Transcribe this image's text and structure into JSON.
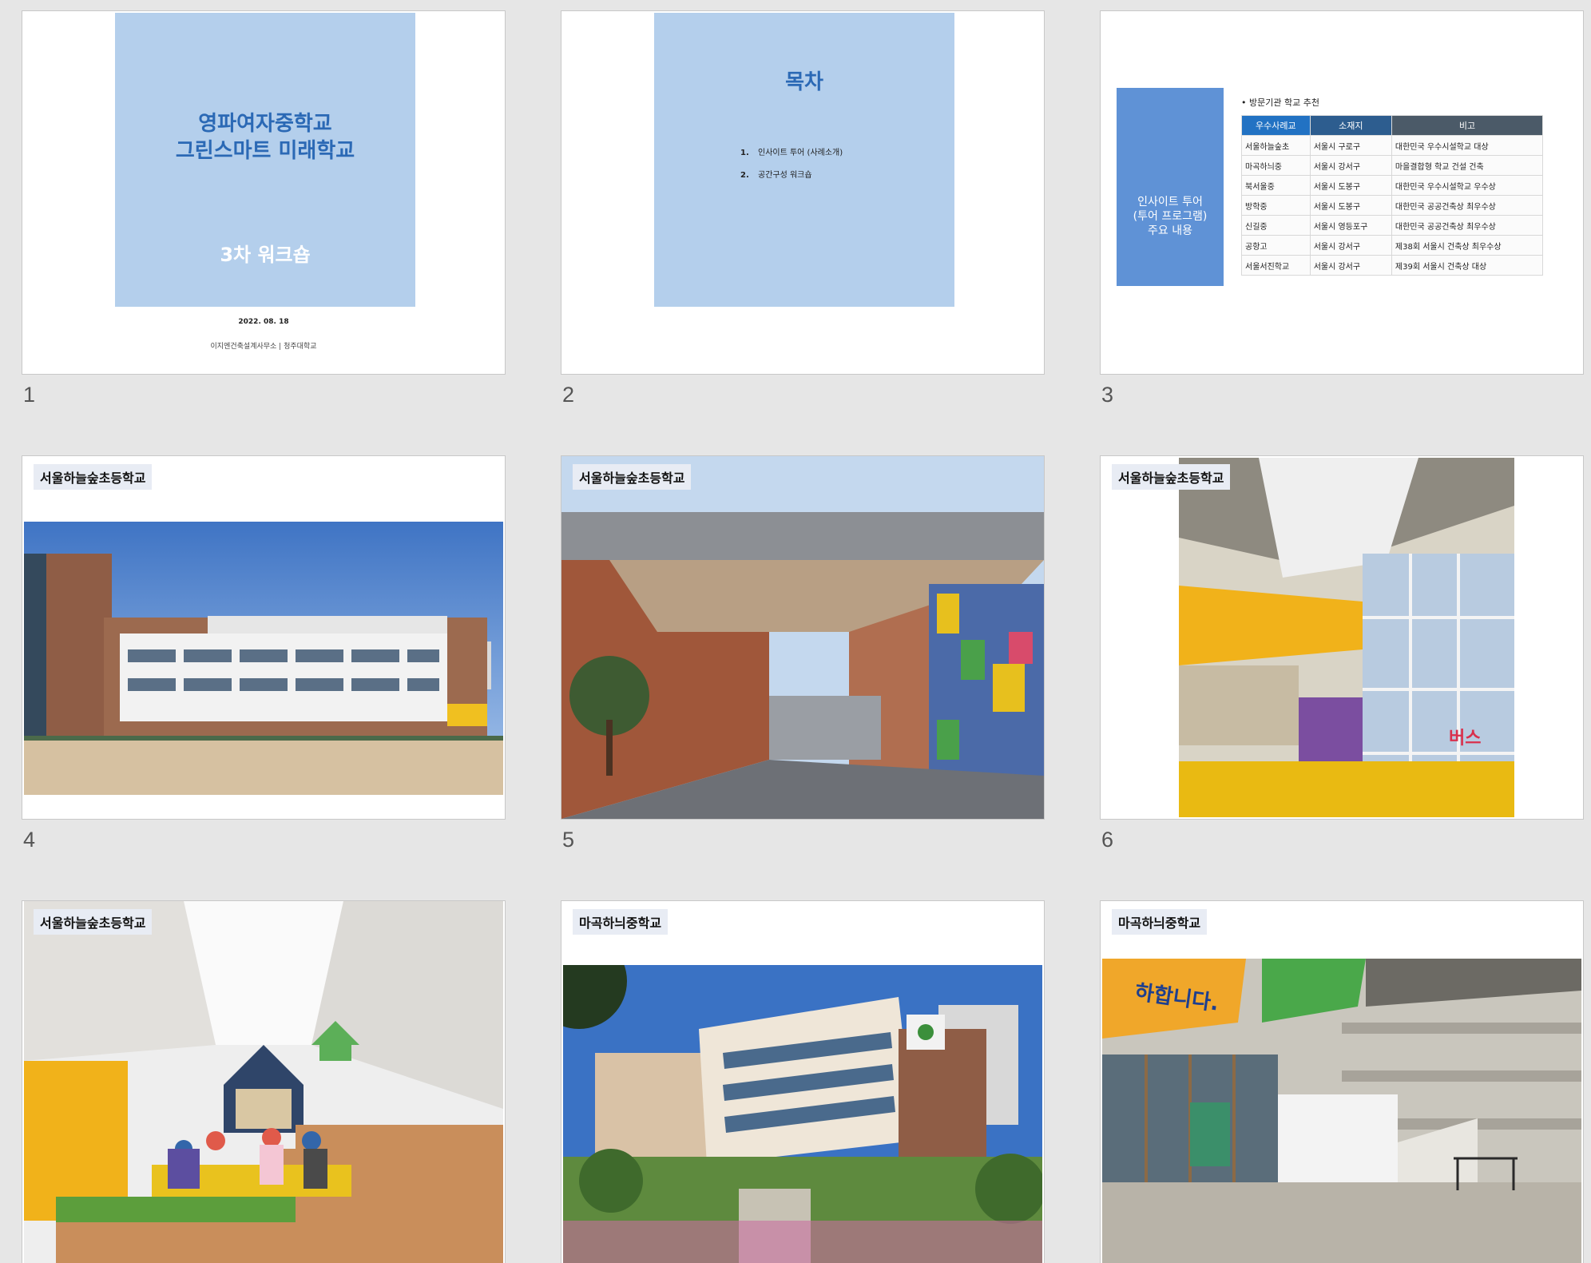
{
  "slides": [
    {
      "number": "1",
      "title": "영파여자중학교\n그린스마트 미래학교",
      "subtitle": "3차 워크숍",
      "date": "2022. 08. 18",
      "organization": "이지엔건축설계사무소 | 청주대학교"
    },
    {
      "number": "2",
      "title": "목차",
      "items": [
        {
          "num": "1.",
          "text": "인사이트 투어 (사례소개)"
        },
        {
          "num": "2.",
          "text": "공간구성 워크숍"
        }
      ]
    },
    {
      "number": "3",
      "left_box": "인사이트 투어\n(투어 프로그램)\n주요 내용",
      "heading": "• 방문기관 학교 추천",
      "table": {
        "headers": [
          "우수사례교",
          "소재지",
          "비고"
        ],
        "rows": [
          [
            "서울하늘숲초",
            "서울시 구로구",
            "대한민국 우수시설학교 대상"
          ],
          [
            "마곡하늬중",
            "서울시 강서구",
            "마을결합형 학교 건설 건축"
          ],
          [
            "북서울중",
            "서울시 도봉구",
            "대한민국 우수시설학교 우수상"
          ],
          [
            "방학중",
            "서울시 도봉구",
            "대한민국 공공건축상 최우수상"
          ],
          [
            "신길중",
            "서울시 영등포구",
            "대한민국 공공건축상 최우수상"
          ],
          [
            "공항고",
            "서울시 강서구",
            "제38회 서울시 건축상 최우수상"
          ],
          [
            "서울서진학교",
            "서울시 강서구",
            "제39회 서울시 건축상 대상"
          ]
        ]
      }
    },
    {
      "number": "4",
      "label": "서울하늘숲초등학교"
    },
    {
      "number": "5",
      "label": "서울하늘숲초등학교"
    },
    {
      "number": "6",
      "label": "서울하늘숲초등학교",
      "sign": "버스"
    },
    {
      "number": "7",
      "label": "서울하늘숲초등학교"
    },
    {
      "number": "8",
      "label": "마곡하늬중학교"
    },
    {
      "number": "9",
      "label": "마곡하늬중학교",
      "banner": "하합니다."
    }
  ],
  "colors": {
    "accent_blue": "#2b69b5",
    "title_box": "#b4cfec",
    "background": "#e6e6e6"
  }
}
